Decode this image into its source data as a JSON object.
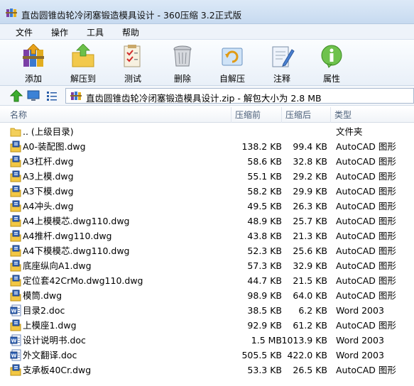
{
  "window": {
    "title": "直齿圆锥齿轮冷闭塞锻造模具设计 - 360压缩 3.2正式版"
  },
  "menu": [
    "文件",
    "操作",
    "工具",
    "帮助"
  ],
  "toolbar": [
    {
      "label": "添加",
      "icon": "add-archive-icon"
    },
    {
      "label": "解压到",
      "icon": "extract-to-icon"
    },
    {
      "label": "测试",
      "icon": "test-icon"
    },
    {
      "label": "删除",
      "icon": "delete-icon"
    },
    {
      "label": "自解压",
      "icon": "self-extract-icon"
    },
    {
      "label": "注释",
      "icon": "comment-icon"
    },
    {
      "label": "属性",
      "icon": "info-icon"
    }
  ],
  "pathbar": {
    "text": "直齿圆锥齿轮冷闭塞锻造模具设计.zip - 解包大小为 2.8 MB"
  },
  "columns": {
    "name": "名称",
    "packed": "压缩前",
    "original": "压缩后",
    "type": "类型"
  },
  "files": [
    {
      "name": ".. (上级目录)",
      "packed": "",
      "original": "",
      "type": "文件夹",
      "icon": "folder-icon"
    },
    {
      "name": "A0-装配图.dwg",
      "packed": "138.2 KB",
      "original": "99.4 KB",
      "type": "AutoCAD 图形",
      "icon": "dwg-file-icon"
    },
    {
      "name": "A3杠杆.dwg",
      "packed": "58.6 KB",
      "original": "32.8 KB",
      "type": "AutoCAD 图形",
      "icon": "dwg-file-icon"
    },
    {
      "name": "A3上模.dwg",
      "packed": "55.1 KB",
      "original": "29.2 KB",
      "type": "AutoCAD 图形",
      "icon": "dwg-file-icon"
    },
    {
      "name": "A3下模.dwg",
      "packed": "58.2 KB",
      "original": "29.9 KB",
      "type": "AutoCAD 图形",
      "icon": "dwg-file-icon"
    },
    {
      "name": "A4冲头.dwg",
      "packed": "49.5 KB",
      "original": "26.3 KB",
      "type": "AutoCAD 图形",
      "icon": "dwg-file-icon"
    },
    {
      "name": "A4上模模芯.dwg110.dwg",
      "packed": "48.9 KB",
      "original": "25.7 KB",
      "type": "AutoCAD 图形",
      "icon": "dwg-file-icon"
    },
    {
      "name": "A4推杆.dwg110.dwg",
      "packed": "43.8 KB",
      "original": "21.3 KB",
      "type": "AutoCAD 图形",
      "icon": "dwg-file-icon"
    },
    {
      "name": "A4下模模芯.dwg110.dwg",
      "packed": "52.3 KB",
      "original": "25.6 KB",
      "type": "AutoCAD 图形",
      "icon": "dwg-file-icon"
    },
    {
      "name": "底座纵向A1.dwg",
      "packed": "57.3 KB",
      "original": "32.9 KB",
      "type": "AutoCAD 图形",
      "icon": "dwg-file-icon"
    },
    {
      "name": "定位套42CrMo.dwg110.dwg",
      "packed": "44.7 KB",
      "original": "21.5 KB",
      "type": "AutoCAD 图形",
      "icon": "dwg-file-icon"
    },
    {
      "name": "模筒.dwg",
      "packed": "98.9 KB",
      "original": "64.0 KB",
      "type": "AutoCAD 图形",
      "icon": "dwg-file-icon"
    },
    {
      "name": "目录2.doc",
      "packed": "38.5 KB",
      "original": "6.2 KB",
      "type": "Word 2003",
      "icon": "word-file-icon"
    },
    {
      "name": "上模座1.dwg",
      "packed": "92.9 KB",
      "original": "61.2 KB",
      "type": "AutoCAD 图形",
      "icon": "dwg-file-icon"
    },
    {
      "name": "设计说明书.doc",
      "packed": "1.5 MB",
      "original": "1013.9 KB",
      "type": "Word 2003",
      "icon": "word-file-icon"
    },
    {
      "name": "外文翻译.doc",
      "packed": "505.5 KB",
      "original": "422.0 KB",
      "type": "Word 2003",
      "icon": "word-file-icon"
    },
    {
      "name": "支承板40Cr.dwg",
      "packed": "53.3 KB",
      "original": "26.5 KB",
      "type": "AutoCAD 图形",
      "icon": "dwg-file-icon"
    }
  ]
}
